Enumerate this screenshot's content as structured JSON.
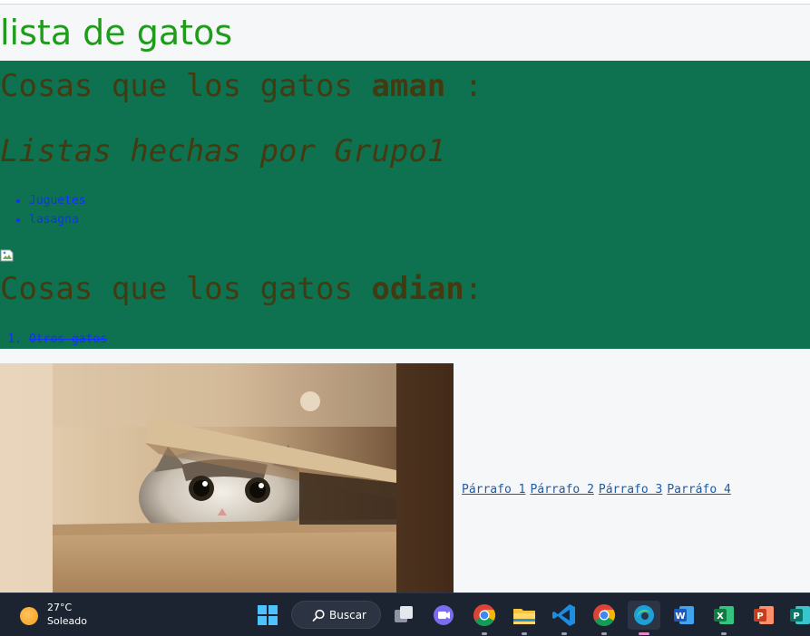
{
  "page": {
    "title": "lista de gatos",
    "love_heading_prefix": "Cosas que los gatos ",
    "love_heading_bold": "aman",
    "love_heading_suffix": " :",
    "subtitle": "Listas hechas por Grupo1",
    "love_items": [
      "Juguetes",
      "lasagna"
    ],
    "hate_heading_prefix": "Cosas que los gatos ",
    "hate_heading_bold": "odian",
    "hate_heading_suffix": ":",
    "hate_items": [
      "Otros gatos"
    ],
    "links": [
      "Párrafo 1",
      "Párrafo 2",
      "Párrafo 3",
      "Parráfo 4"
    ]
  },
  "colors": {
    "title_green": "#1f9c1a",
    "section_bg": "#0e7250",
    "heading_text": "#443a12",
    "list_text": "#1230ff",
    "link": "#1f5aa8"
  },
  "taskbar": {
    "weather_temp": "27°C",
    "weather_condition": "Soleado",
    "weather_icon": "sun-icon",
    "search_label": "Buscar",
    "apps": [
      "windows-start-icon",
      "search-icon",
      "task-view-icon",
      "teams-chat-icon",
      "chrome-icon",
      "file-explorer-icon",
      "vscode-icon",
      "chrome-icon",
      "edge-icon",
      "word-icon",
      "excel-icon",
      "powerpoint-icon",
      "publisher-icon"
    ]
  }
}
